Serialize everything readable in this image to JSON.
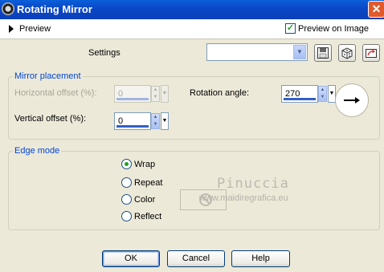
{
  "window": {
    "title": "Rotating Mirror",
    "close_label": "✕"
  },
  "preview": {
    "label": "Preview",
    "preview_on_image_label": "Preview on Image",
    "preview_on_image_checked": true
  },
  "settings": {
    "label": "Settings",
    "preset_value": ""
  },
  "mirror_placement": {
    "title": "Mirror placement",
    "horizontal_offset_label": "Horizontal offset (%):",
    "horizontal_offset_value": "0",
    "vertical_offset_label": "Vertical offset (%):",
    "vertical_offset_value": "0",
    "rotation_angle_label": "Rotation angle:",
    "rotation_angle_value": "270"
  },
  "edge_mode": {
    "title": "Edge mode",
    "options": [
      "Wrap",
      "Repeat",
      "Color",
      "Reflect"
    ],
    "selected": "Wrap"
  },
  "watermark": {
    "line1": "Pinuccia",
    "line2": "www.maidiregrafica.eu"
  },
  "buttons": {
    "ok": "OK",
    "cancel": "Cancel",
    "help": "Help"
  },
  "colors": {
    "title_bar": "#0a48c8",
    "group_title": "#0046d5",
    "selected_radio": "#21a121"
  }
}
